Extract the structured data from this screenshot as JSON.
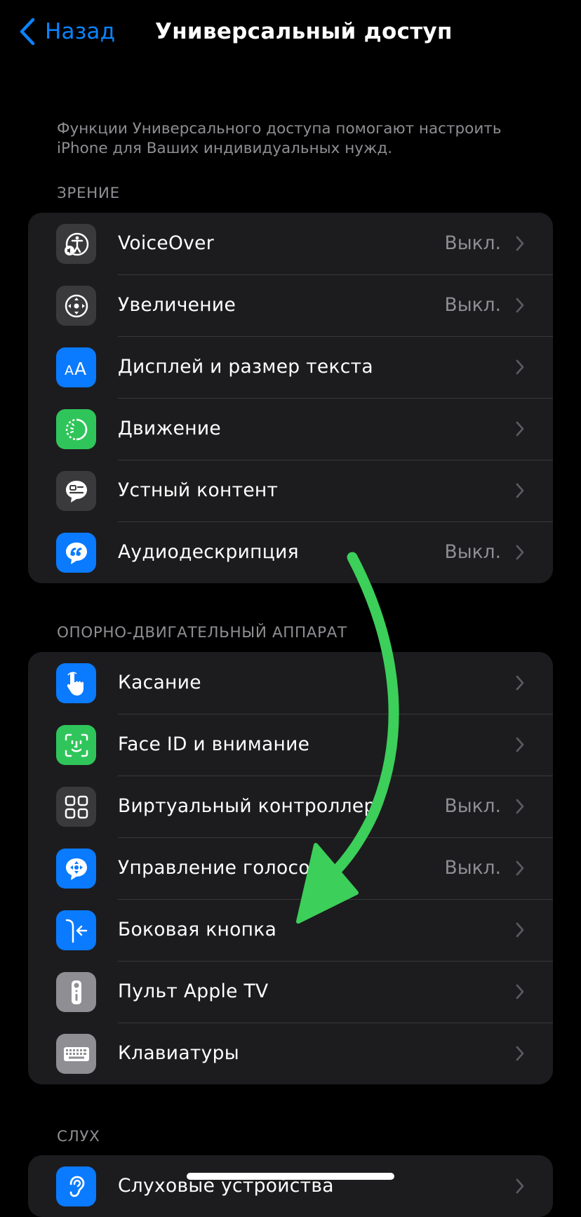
{
  "nav": {
    "back_label": "Назад",
    "title": "Универсальный доступ"
  },
  "intro": "Функции Универсального доступа помогают настроить iPhone для Ваших индивидуальных нужд.",
  "sections": {
    "vision": {
      "header": "ЗРЕНИЕ",
      "items": [
        {
          "label": "VoiceOver",
          "value": "Выкл.",
          "icon": "voiceover-icon",
          "icon_bg": "#3a3a3c"
        },
        {
          "label": "Увеличение",
          "value": "Выкл.",
          "icon": "zoom-icon",
          "icon_bg": "#3a3a3c"
        },
        {
          "label": "Дисплей и размер текста",
          "value": "",
          "icon": "text-size-icon",
          "icon_bg": "#0a7aff"
        },
        {
          "label": "Движение",
          "value": "",
          "icon": "motion-icon",
          "icon_bg": "#30c55a"
        },
        {
          "label": "Устный контент",
          "value": "",
          "icon": "spoken-content-icon",
          "icon_bg": "#3a3a3c"
        },
        {
          "label": "Аудиодескрипция",
          "value": "Выкл.",
          "icon": "audio-description-icon",
          "icon_bg": "#0a7aff"
        }
      ]
    },
    "motor": {
      "header": "ОПОРНО-ДВИГАТЕЛЬНЫЙ АППАРАТ",
      "items": [
        {
          "label": "Касание",
          "value": "",
          "icon": "touch-hand-icon",
          "icon_bg": "#0a7aff"
        },
        {
          "label": "Face ID и внимание",
          "value": "",
          "icon": "face-id-icon",
          "icon_bg": "#30c55a"
        },
        {
          "label": "Виртуальный контроллер",
          "value": "Выкл.",
          "icon": "switch-control-icon",
          "icon_bg": "#3a3a3c"
        },
        {
          "label": "Управление голосом",
          "value": "Выкл.",
          "icon": "voice-control-icon",
          "icon_bg": "#0a7aff"
        },
        {
          "label": "Боковая кнопка",
          "value": "",
          "icon": "side-button-icon",
          "icon_bg": "#0a7aff"
        },
        {
          "label": "Пульт Apple TV",
          "value": "",
          "icon": "apple-tv-remote-icon",
          "icon_bg": "#8e8e93"
        },
        {
          "label": "Клавиатуры",
          "value": "",
          "icon": "keyboard-icon",
          "icon_bg": "#8e8e93"
        }
      ]
    },
    "hearing": {
      "header": "СЛУХ",
      "items": [
        {
          "label": "Слуховые устройства",
          "value": "",
          "icon": "hearing-devices-icon",
          "icon_bg": "#0a7aff"
        }
      ]
    }
  },
  "annotation_color": "#3ccf5a",
  "accent_color": "#0a84ff"
}
